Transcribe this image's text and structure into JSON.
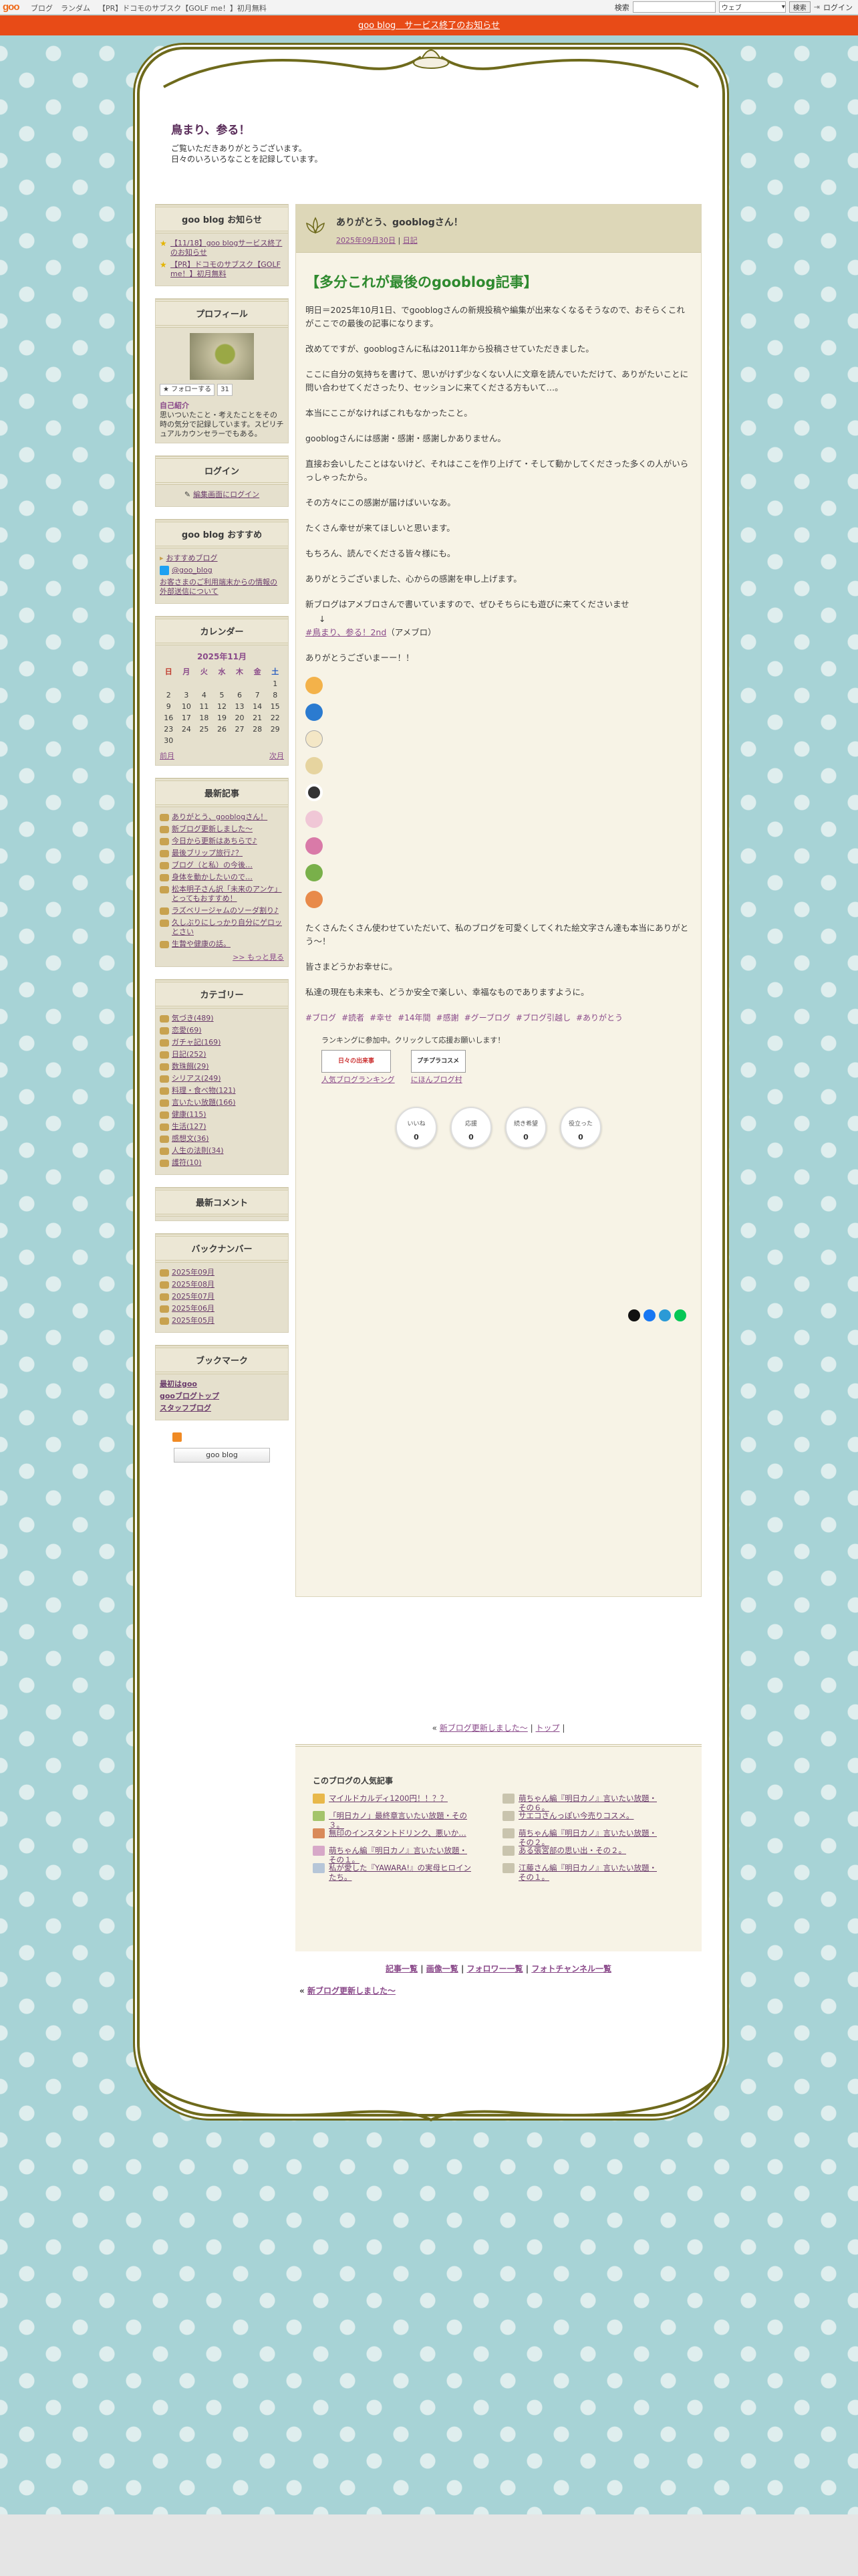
{
  "topbar": {
    "logo": "goo",
    "links": [
      "ブログ",
      "ランダム",
      "【PR】ドコモのサブスク【GOLF me！】初月無料"
    ],
    "search_label": "検索",
    "search_placeholder": "",
    "select_value": "ウェブ",
    "search_button": "検索",
    "login": "ログイン"
  },
  "notice": {
    "text": "goo blog　サービス終了のお知らせ"
  },
  "blog": {
    "title": "鳥まり、参る！",
    "desc1": "ご覧いただきありがとうございます。",
    "desc2": "日々のいろいろなことを記録しています。"
  },
  "sidebar": {
    "notice": {
      "title": "goo blog お知らせ",
      "items": [
        "【11/18】goo blogサービス終了のお知らせ",
        "【PR】ドコモのサブスク【GOLF me！】初月無料"
      ]
    },
    "profile": {
      "title": "プロフィール",
      "follow": "フォローする",
      "follow_count": "31",
      "intro_label": "自己紹介",
      "intro": "思いついたこと・考えたことをその時の気分で記録しています。スピリチュアルカウンセラーでもある。"
    },
    "login": {
      "title": "ログイン",
      "link": "編集画面にログイン"
    },
    "recommend": {
      "title": "goo blog おすすめ",
      "items": [
        "おすすめブログ",
        "@goo_blog",
        "お客さまのご利用端末からの情報の外部送信について"
      ]
    },
    "calendar": {
      "title": "カレンダー",
      "month": "2025年11月",
      "week": [
        "日",
        "月",
        "火",
        "水",
        "木",
        "金",
        "土"
      ],
      "rows": [
        [
          "",
          "",
          "",
          "",
          "",
          "",
          "1"
        ],
        [
          "2",
          "3",
          "4",
          "5",
          "6",
          "7",
          "8"
        ],
        [
          "9",
          "10",
          "11",
          "12",
          "13",
          "14",
          "15"
        ],
        [
          "16",
          "17",
          "18",
          "19",
          "20",
          "21",
          "22"
        ],
        [
          "23",
          "24",
          "25",
          "26",
          "27",
          "28",
          "29"
        ],
        [
          "30",
          "",
          "",
          "",
          "",
          "",
          ""
        ]
      ],
      "prev": "前月",
      "next": "次月"
    },
    "recent": {
      "title": "最新記事",
      "items": [
        "ありがとう、gooblogさん！",
        "新ブログ更新しました～",
        "今日から更新はあちらで♪",
        "最後ブリップ旅行♪？",
        "ブログ（と私）の今後…",
        "身体を動かしたいので…",
        "松本明子さん訳「未来のアンケ」とってもおすすめ！",
        "ラズベリージャムのソーダ割り♪",
        "久しぶりにしっかり自分にゲロッとさい",
        "生贄や健康の話。"
      ],
      "more": ">> もっと見る"
    },
    "category": {
      "title": "カテゴリー",
      "items": [
        "気づき(489)",
        "恋愛(69)",
        "ガチャ記(169)",
        "日記(252)",
        "数珠餌(29)",
        "シリアス(249)",
        "料理・食べ物(121)",
        "言いたい放題(166)",
        "健康(115)",
        "生活(127)",
        "感想文(36)",
        "人生の法則(34)",
        "護符(10)"
      ]
    },
    "comments": {
      "title": "最新コメント"
    },
    "backnumber": {
      "title": "バックナンバー",
      "items": [
        "2025年09月",
        "2025年08月",
        "2025年07月",
        "2025年06月",
        "2025年05月"
      ]
    },
    "bookmark": {
      "title": "ブックマーク",
      "items": [
        "最初はgoo",
        "gooブログトップ",
        "スタッフブログ"
      ]
    },
    "badge": "goo blog"
  },
  "post": {
    "title": "ありがとう、gooblogさん！",
    "date": "2025年09月30日",
    "category": "日記",
    "heading": "【多分これが最後のgooblog記事】",
    "paragraphs": [
      "明日＝2025年10月1日、でgooblogさんの新規投稿や編集が出来なくなるそうなので、おそらくこれがここでの最後の記事になります。",
      "改めてですが、gooblogさんに私は2011年から投稿させていただきました。",
      "ここに自分の気持ちを書けて、思いがけず少なくない人に文章を読んでいただけて、ありがたいことに問い合わせてくださったり、セッションに来てくださる方もいて…。",
      "本当にここがなければこれもなかったこと。",
      "gooblogさんには感謝・感謝・感謝しかありません。",
      "直接お会いしたことはないけど、それはここを作り上げて・そして動かしてくださった多くの人がいらっしゃったから。",
      "その方々にこの感謝が届けばいいなあ。",
      "たくさん幸せが来てほしいと思います。",
      "もちろん、読んでくださる皆々様にも。",
      "ありがとうございました、心からの感謝を申し上げます。",
      "新ブログはアメブロさんで書いていますので、ぜひそちらにも遊びに来てくださいませ"
    ],
    "arrow": "↓",
    "newblog_link": "#鳥まり、参る！2nd",
    "newblog_suffix": "（アメブロ）",
    "thanks": "ありがとうございまーー！！",
    "closing1": "たくさんたくさん使わせていただいて、私のブログを可愛くしてくれた絵文字さん達も本当にありがとう～！",
    "closing2": "皆さまどうかお幸せに。",
    "closing3": "私達の現在も未来も、どうか安全で楽しい、幸福なものでありますように。",
    "tags": [
      "#ブログ",
      "#読者",
      "#幸せ",
      "#14年間",
      "#感謝",
      "#グーブログ",
      "#ブログ引越し",
      "#ありがとう"
    ],
    "ranking_text": "ランキングに参加中。クリックして応援お願いします！",
    "rank1": "人気ブログランキング",
    "rank2": "にほんブログ村",
    "rank1_badge": "日々の出来事",
    "rank2_badge": "プチプラコスメ",
    "reactions": [
      {
        "label": "いいね",
        "count": "0"
      },
      {
        "label": "応援",
        "count": "0"
      },
      {
        "label": "続き希望",
        "count": "0"
      },
      {
        "label": "役立った",
        "count": "0"
      }
    ]
  },
  "pager": {
    "prev": "新ブログ更新しました～",
    "top": "トップ"
  },
  "popular": {
    "title": "このブログの人気記事",
    "left": [
      "マイルドカルディ1200円！！？？",
      "「明日カノ」最終章言いたい放題・その３。",
      "無印のインスタントドリンク、悪いか…",
      "萌ちゃん編『明日カノ』言いたい放題・その１。",
      "私が愛した『YAWARA!』の実母ヒロインたち。"
    ],
    "right": [
      "萌ちゃん編『明日カノ』言いたい放題・その６。",
      "サエコさんっぽい今売りコスメ。",
      "萌ちゃん編『明日カノ』言いたい放題・その２。",
      "ある張宮部の思い出・その２。",
      "江藤さん編『明日カノ』言いたい放題・その１。"
    ]
  },
  "footer": {
    "links": [
      "記事一覧",
      "画像一覧",
      "フォロワー一覧",
      "フォトチャンネル一覧"
    ],
    "prev": "新ブログ更新しました～"
  },
  "colors": {
    "accent": "#e84b17",
    "title_green": "#2f8a2f",
    "link_purple": "#8a4a8a",
    "frame": "#6e6a1c",
    "sidebar_bg": "#e5e0cd"
  }
}
